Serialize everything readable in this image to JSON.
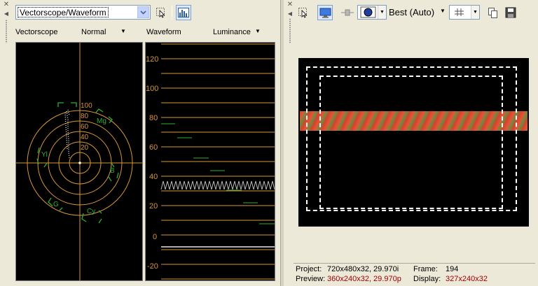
{
  "scopes": {
    "selected_scope": "Vectorscope/Waveform",
    "vectorscope_label": "Vectorscope",
    "vectorscope_mode": "Normal",
    "waveform_label": "Waveform",
    "waveform_mode": "Luminance",
    "vector_ring_labels": [
      "100",
      "80",
      "60",
      "40",
      "20"
    ],
    "vector_targets": [
      "Mg",
      "Yl",
      "B",
      "G",
      "Cy"
    ],
    "waveform_axis_labels": [
      "120",
      "100",
      "80",
      "60",
      "40",
      "20",
      "0",
      "-20"
    ]
  },
  "preview": {
    "quality": "Best (Auto)",
    "project_label": "Project:",
    "project_value": "720x480x32, 29.970i",
    "frame_label": "Frame:",
    "frame_value": "194",
    "preview_label": "Preview:",
    "preview_value": "360x240x32, 29.970p",
    "display_label": "Display:",
    "display_value": "327x240x32"
  },
  "colors": {
    "scope_graticule": "#d8963a",
    "scope_target": "#2fae32",
    "axis_label": "#d8963a",
    "status_red": "#a00000",
    "bar_red": "#d2432c",
    "bar_green": "#6e8a3f"
  }
}
